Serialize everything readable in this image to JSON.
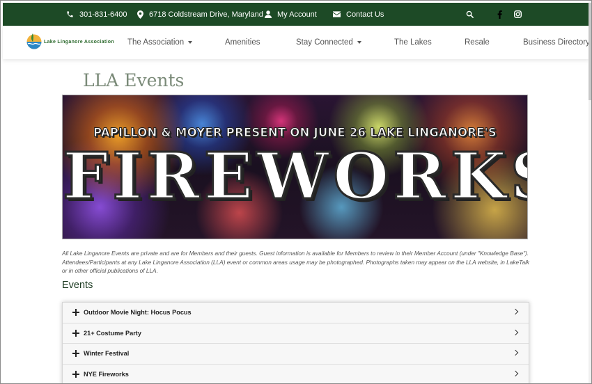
{
  "topbar": {
    "phone": "301-831-6400",
    "address": "6718 Coldstream Drive, Maryland",
    "account": "My Account",
    "contact": "Contact Us",
    "icons": [
      "phone-icon",
      "map-pin-icon",
      "user-icon",
      "envelope-icon",
      "search-icon",
      "facebook-icon",
      "instagram-icon"
    ],
    "background": "#1d4a26"
  },
  "nav": {
    "logo_text": "Lake Linganore Association",
    "items": [
      {
        "label": "The Association",
        "dropdown": true
      },
      {
        "label": "Amenities",
        "dropdown": false
      },
      {
        "label": "Stay Connected",
        "dropdown": true
      },
      {
        "label": "The Lakes",
        "dropdown": false
      },
      {
        "label": "Resale",
        "dropdown": false
      },
      {
        "label": "Business Directory",
        "dropdown": false
      }
    ]
  },
  "page": {
    "title": "LLA Events",
    "banner": {
      "subtitle": "PAPILLON & MOYER PRESENT ON JUNE 26 LAKE LINGANORE'S",
      "headline": "FIREWORKS"
    },
    "disclaimer": "All Lake Linganore Events are private and are for Members and their guests. Guest information is available for Members to review in their Member Account (under \"Knowledge Base\").  Attendees/Participants at any Lake Linganore Association (LLA) event or common areas usage may be photographed. Photographs taken may appear on the LLA website, in LakeTalk or in other official publications of LLA.",
    "events_heading": "Events",
    "events": [
      {
        "label": "Outdoor Movie Night: Hocus Pocus"
      },
      {
        "label": "21+ Costume Party"
      },
      {
        "label": "Winter Festival"
      },
      {
        "label": "NYE Fireworks"
      }
    ]
  }
}
